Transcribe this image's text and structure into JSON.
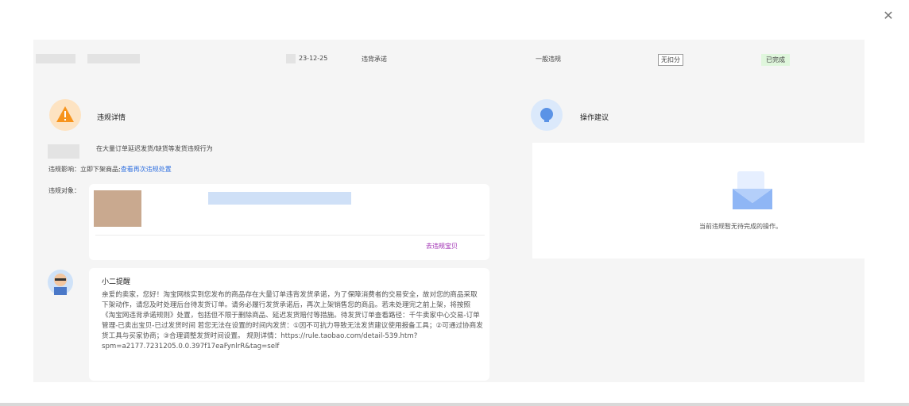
{
  "header": {
    "date": "23-12-25",
    "type": "违背承诺",
    "level": "一般违规",
    "tag": "无扣分",
    "status": "已完成"
  },
  "violation_details": {
    "title": "违规详情",
    "description": "在大量订单延迟发货/缺货等发货违规行为",
    "impact_label": "违规影响：",
    "impact_value": "立即下架商品;",
    "impact_link": "查看再次违规处置",
    "target_label": "违规对象：",
    "go_link": "去违规宝贝"
  },
  "suggestion": {
    "title": "操作建议",
    "empty_text": "当前违规暂无待完成的操作。"
  },
  "notice": {
    "title": "小二提醒",
    "body": "亲爱的卖家，您好！淘宝网核实到您发布的商品存在大量订单违背发货承诺，为了保障消费者的交易安全，故对您的商品采取下架动作，请您及时处理后台待发货订单。请务必履行发货承诺后，再次上架销售您的商品。若未处理完之前上架，将按照《淘宝网违背承诺规则》处置，包括但不限于删除商品、延迟发货赔付等措施。待发货订单查看路径：千牛卖家中心交易-订单管理-已卖出宝贝-已过发货时间 若您无法在设置的时间内发货：①因不可抗力导致无法发货建议使用报备工具；②可通过协商发货工具与买家协商；③合理调整发货时间设置。 规则详情：https://rule.taobao.com/detail-539.htm?spm=a2177.7231205.0.0.397f17eaFynlrR&tag=self"
  }
}
